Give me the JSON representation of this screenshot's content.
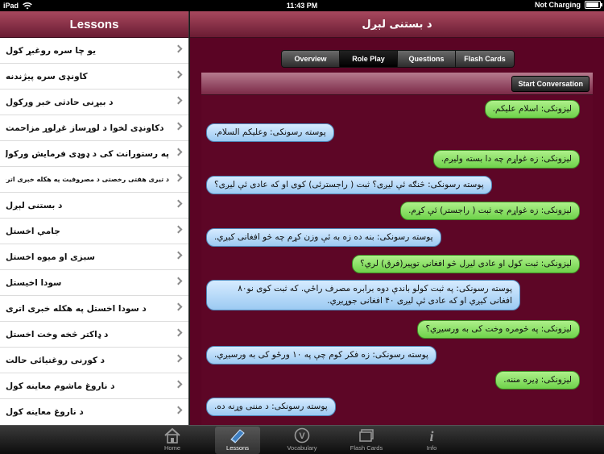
{
  "status_bar": {
    "device": "iPad",
    "time": "11:43 PM",
    "charging": "Not Charging"
  },
  "lessons_panel": {
    "title": "Lessons",
    "items": [
      "یو چا سره روغبړ کول",
      "کاونډی سره پیژندنه",
      "د بیړنی حادثی خبر ورکول",
      "دکاونډی لخوا د لوړساز غږلوړ مزاحمت",
      "په رستورانت کی د ډوډی فرمایش ورکول",
      "د تیری هفتی رخصتی د مصروفیت په هکله خبری اتری",
      "د بستنی لېږل",
      "جامې اخستل",
      "سبزی او میوه اخستل",
      "سودا اخیستل",
      "د سودا اخستل په هکله خبری اتری",
      "د ډاکتر څخه وخت اخستل",
      "د کورنی روغتیائی حالت",
      "د ناروغ ماشوم معاینه کول",
      "د ناروغ معاینه کول"
    ]
  },
  "content_panel": {
    "title": "د بستنی لېږل",
    "segments": [
      "Overview",
      "Role Play",
      "Questions",
      "Flash Cards"
    ],
    "active_segment": 1,
    "start_button": "Start Conversation",
    "messages": [
      {
        "speaker": "a",
        "text": "لیزونکی: اسلام علیکم."
      },
      {
        "speaker": "b",
        "text": "پوسته رسونکی: وعلیکم السلام."
      },
      {
        "speaker": "a",
        "text": "لیزونکی: زه غواړم چه دا بسته ولیږم."
      },
      {
        "speaker": "b",
        "text": "پوسته رسونکی: څنګه ئې لیږی؟ ثبت ( راجسترئی) کوی او که عادی ئې لیږی؟"
      },
      {
        "speaker": "a",
        "text": "لیزونکی: زه غواړم چه ثبت ( راجستر) ئې کړم."
      },
      {
        "speaker": "b",
        "text": "پوسته رسونکی: بنه ده زه به ئې وزن کړم چه څو افغانی کیږي."
      },
      {
        "speaker": "a",
        "text": "لیزونکی: ثبت کول او عادی لیږل څو افغانی توپیر(فرق) لري؟"
      },
      {
        "speaker": "b",
        "text": "پوسته رسونکی: په ثبت کولو باندې دوه برابره مصرف راځي. که ثبت کوی نو۸۰ افغانی کیږي او که عادی ئې لیږی ۴۰ افغانی جوړیږي."
      },
      {
        "speaker": "a",
        "text": "لیزونکی: په څومره وخت کی به ورسیږي؟"
      },
      {
        "speaker": "b",
        "text": "پوسته رسونکی: زه فکر کوم چې په ۱۰ ورځو کی به ورسیږي."
      },
      {
        "speaker": "a",
        "text": "لیزونکی: ډیره مننه."
      },
      {
        "speaker": "b",
        "text": "پوسته رسونکی: د مننی وړنه ده."
      }
    ]
  },
  "tab_bar": {
    "tabs": [
      {
        "label": "Home",
        "icon": "home-icon"
      },
      {
        "label": "Lessons",
        "icon": "book-icon"
      },
      {
        "label": "Vocabulary",
        "icon": "vocabulary-icon"
      },
      {
        "label": "Flash Cards",
        "icon": "flash-cards-icon"
      },
      {
        "label": "Info",
        "icon": "info-icon"
      }
    ],
    "active_tab": 1
  },
  "colors": {
    "accent": "#7b2a47",
    "chat_bg": "#5d0626",
    "bubble_green": "#7fdc5a",
    "bubble_blue": "#b5d9f8"
  }
}
